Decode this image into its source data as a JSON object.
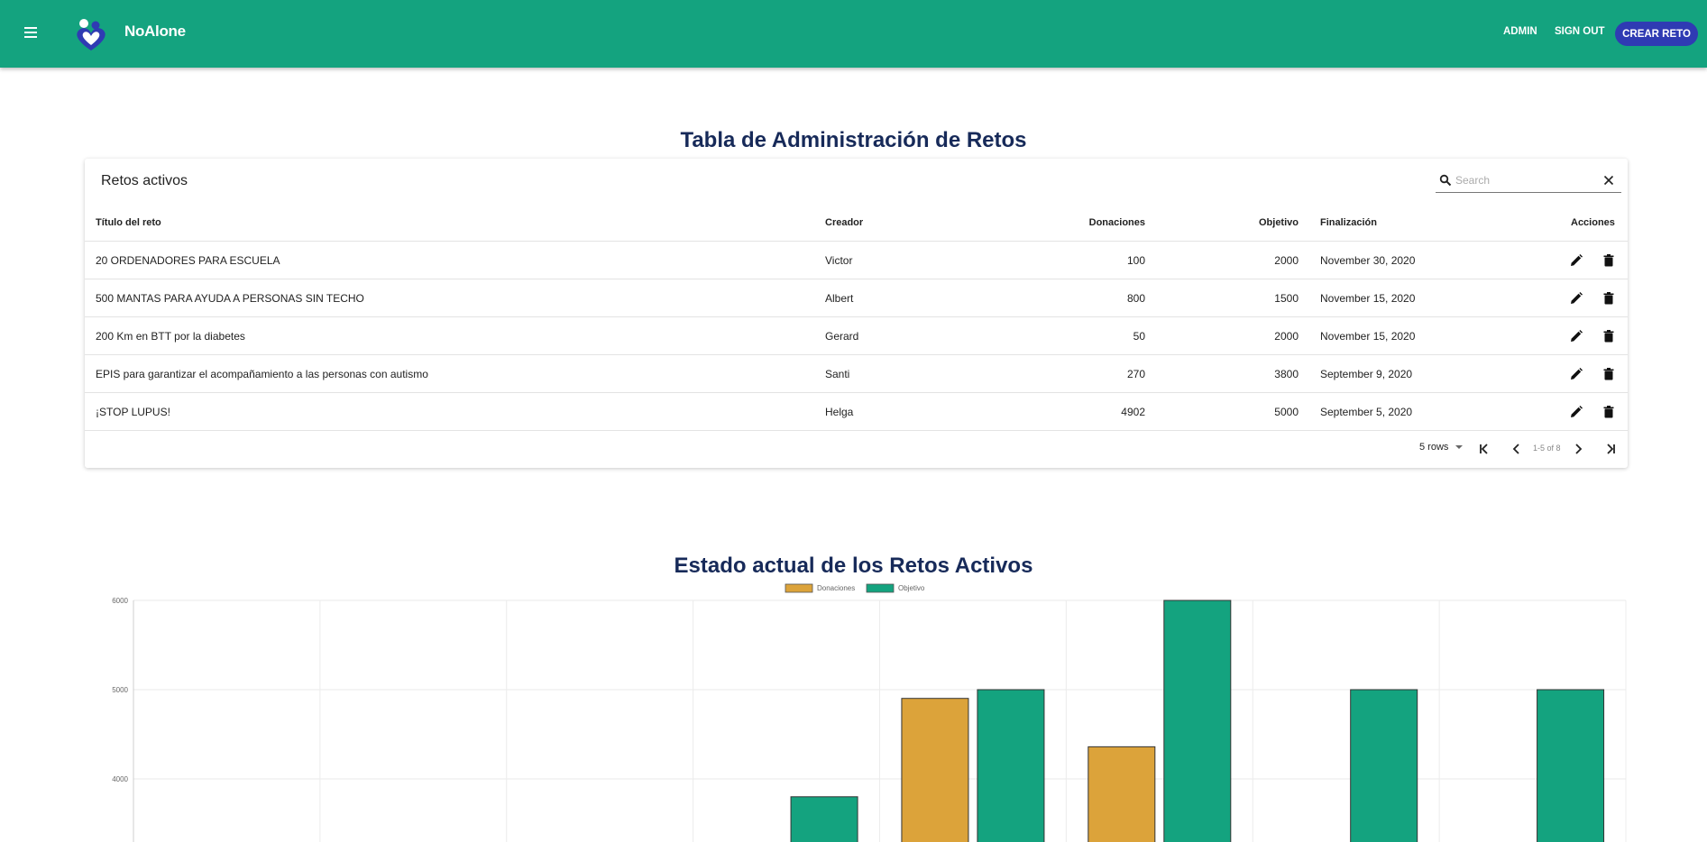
{
  "header": {
    "brand": "NoAlone",
    "nav": [
      "ADMIN",
      "SIGN OUT"
    ],
    "cta": "CREAR RETO",
    "colors": {
      "appbar": "#14a37f",
      "cta": "#2f3bb3"
    }
  },
  "table_section": {
    "heading": "Tabla de Administración de Retos",
    "card_title": "Retos activos",
    "search_placeholder": "Search",
    "columns": [
      "Título del reto",
      "Creador",
      "Donaciones",
      "Objetivo",
      "Finalización",
      "Acciones"
    ],
    "rows": [
      {
        "title": "20 ORDENADORES PARA ESCUELA",
        "creator": "Victor",
        "donations": "100",
        "goal": "2000",
        "end": "November 30, 2020"
      },
      {
        "title": "500 MANTAS PARA AYUDA A PERSONAS SIN TECHO",
        "creator": "Albert",
        "donations": "800",
        "goal": "1500",
        "end": "November 15, 2020"
      },
      {
        "title": "200 Km en BTT por la diabetes",
        "creator": "Gerard",
        "donations": "50",
        "goal": "2000",
        "end": "November 15, 2020"
      },
      {
        "title": "EPIS para garantizar el acompañamiento a las personas con autismo",
        "creator": "Santi",
        "donations": "270",
        "goal": "3800",
        "end": "September 9, 2020"
      },
      {
        "title": "¡STOP LUPUS!",
        "creator": "Helga",
        "donations": "4902",
        "goal": "5000",
        "end": "September 5, 2020"
      }
    ],
    "pagination": {
      "rows_per_page": "5 rows",
      "range": "1-5 of 8"
    }
  },
  "chart_section": {
    "heading": "Estado actual de los Retos Activos"
  },
  "chart_data": {
    "type": "bar",
    "categories": [
      "",
      "",
      "",
      "",
      "",
      "",
      "",
      ""
    ],
    "series": [
      {
        "name": "Donaciones",
        "color": "#dca33a",
        "values": [
          null,
          null,
          null,
          null,
          4902,
          4360,
          null,
          null
        ]
      },
      {
        "name": "Objetivo",
        "color": "#14a37f",
        "values": [
          null,
          null,
          null,
          3800,
          5000,
          6000,
          5000,
          5000
        ]
      }
    ],
    "ylim": [
      3000,
      6000
    ],
    "yticks": [
      6000,
      5000,
      4000
    ],
    "grid": true,
    "legend": "top-center"
  }
}
